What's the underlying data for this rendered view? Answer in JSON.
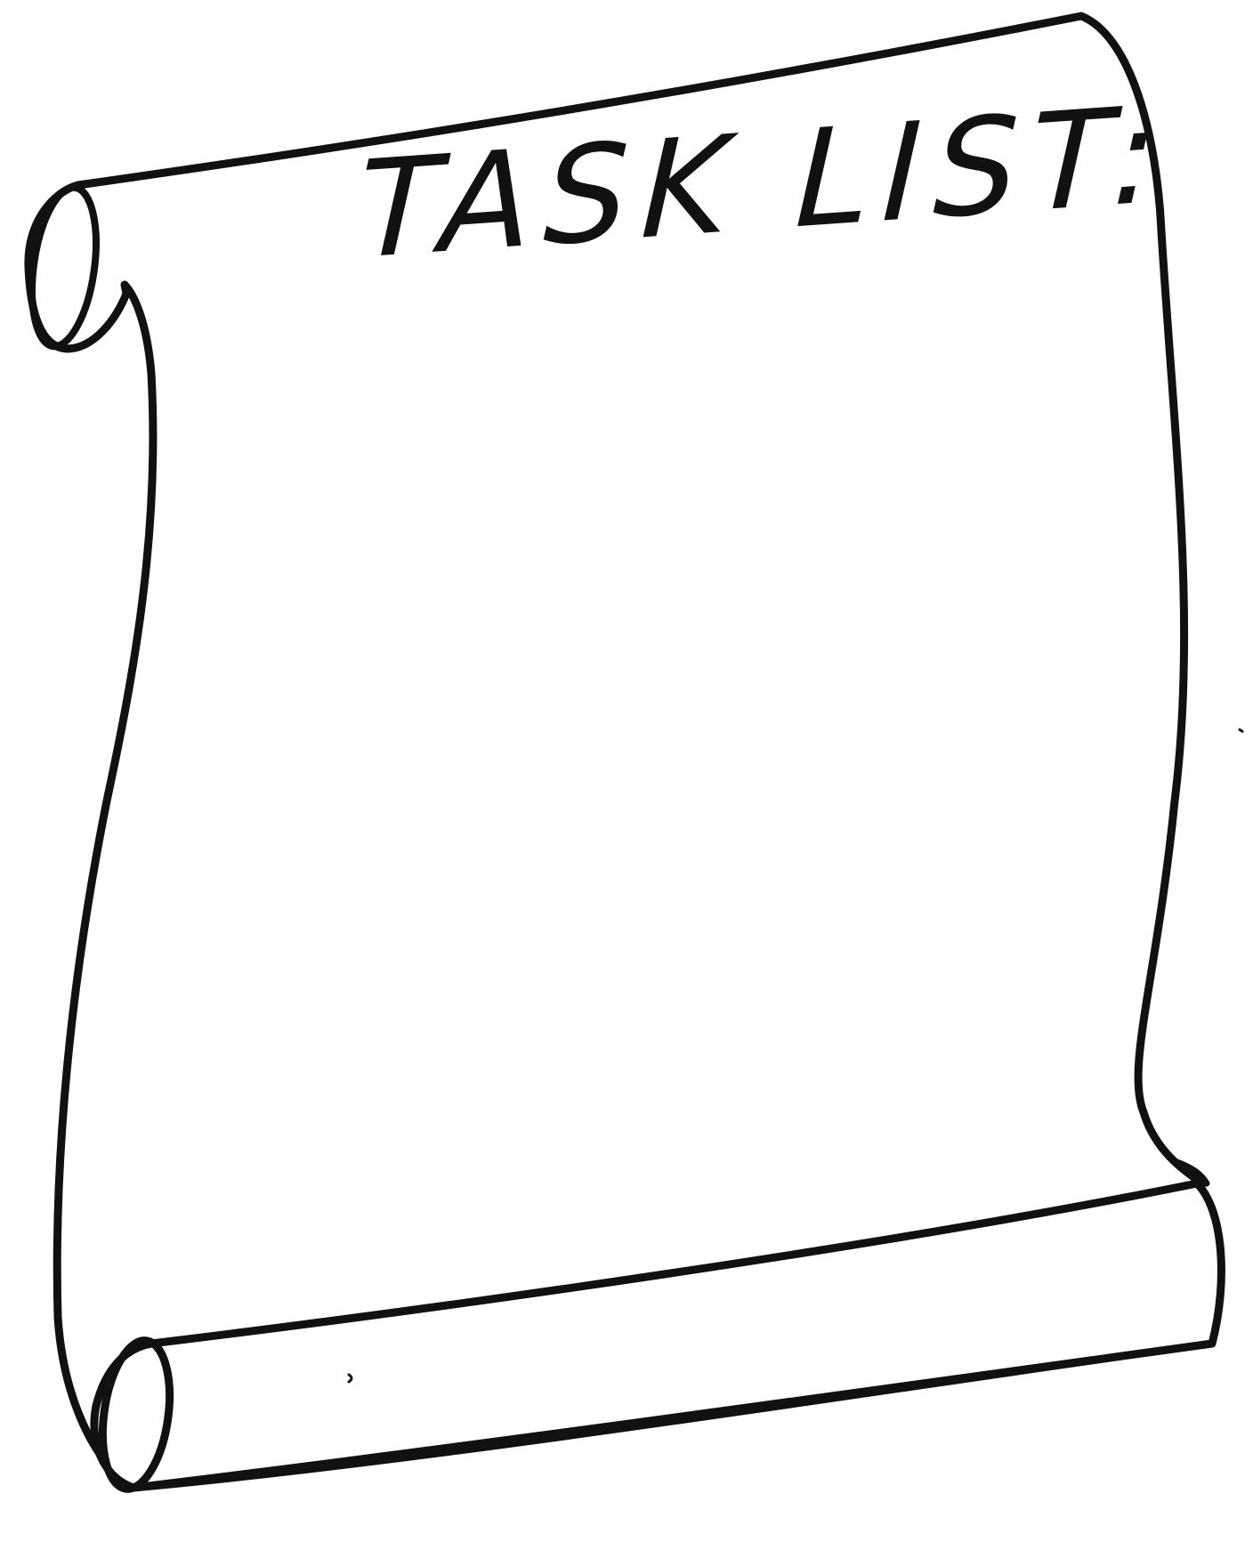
{
  "scroll": {
    "title": "TASK LIST:"
  },
  "colors": {
    "ink": "#111111",
    "paper": "#ffffff"
  },
  "icons": {
    "top_roll": "scroll-top-roll-icon",
    "bottom_roll": "scroll-bottom-roll-icon"
  }
}
